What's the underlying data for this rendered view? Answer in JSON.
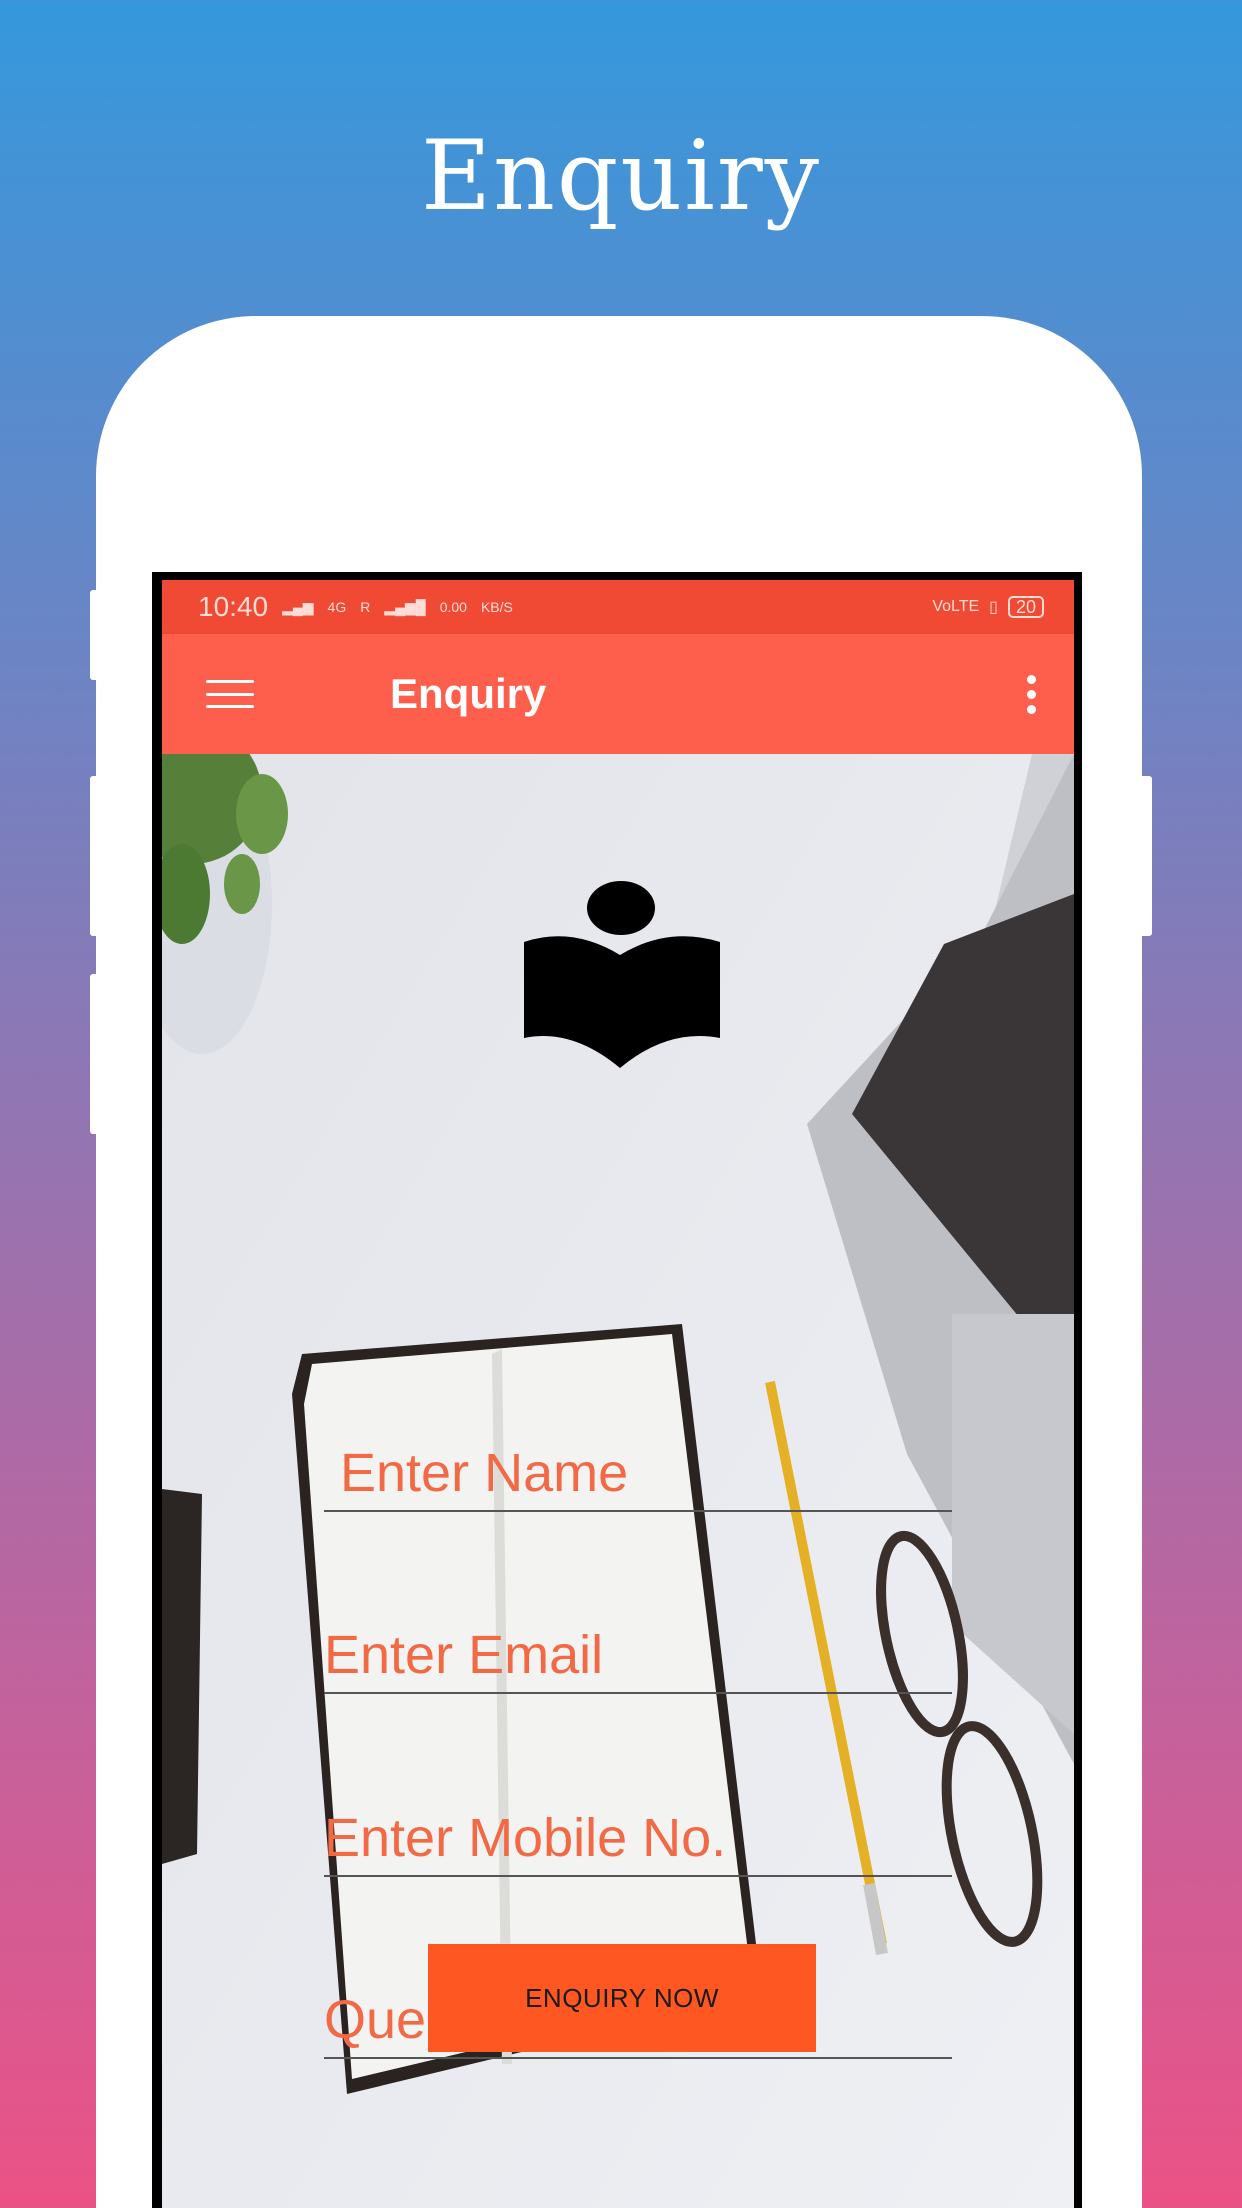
{
  "promo": {
    "title": "Enquiry"
  },
  "status_bar": {
    "time": "10:40",
    "network": "4G",
    "roaming": "R",
    "speed_value": "0.00",
    "speed_unit": "KB/S",
    "volte": "VoLTE",
    "battery": "20"
  },
  "app_bar": {
    "title": "Enquiry"
  },
  "form": {
    "name_placeholder": "Enter Name",
    "email_placeholder": "Enter Email",
    "mobile_placeholder": "Enter Mobile No.",
    "query_placeholder": "Query here",
    "submit_label": "ENQUIRY NOW"
  },
  "colors": {
    "status_bar": "#f04a34",
    "app_bar": "#fe5f4c",
    "hint_text": "#f26a45",
    "button": "#ff5722"
  },
  "icons": {
    "menu": "hamburger-icon",
    "overflow": "more-vert-icon",
    "logo": "reading-book-logo"
  }
}
